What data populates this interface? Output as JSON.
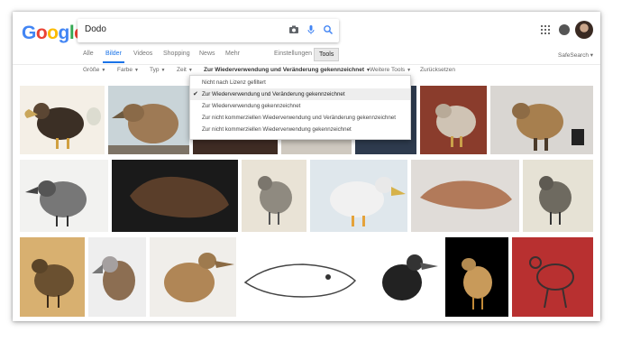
{
  "search": {
    "query": "Dodo"
  },
  "logo": {
    "letters": [
      "G",
      "o",
      "o",
      "g",
      "l",
      "e"
    ]
  },
  "tabs": {
    "items": [
      "Alle",
      "Bilder",
      "Videos",
      "Shopping",
      "News",
      "Mehr"
    ],
    "active": "Bilder",
    "settings": "Einstellungen",
    "tools": "Tools"
  },
  "safesearch": "SafeSearch",
  "filters": {
    "size": "Größe",
    "color": "Farbe",
    "type": "Typ",
    "time": "Zeit",
    "license": "Zur Wiederverwendung und Veränderung gekennzeichnet",
    "more_tools": "Weitere Tools",
    "reset": "Zurücksetzen"
  },
  "license_menu": {
    "options": [
      "Nicht nach Lizenz gefiltert",
      "Zur Wiederverwendung und Veränderung gekennzeichnet",
      "Zur Wiederverwendung gekennzeichnet",
      "Zur nicht kommerziellen Wiederverwendung und Veränderung gekennzeichnet",
      "Zur nicht kommerziellen Wiederverwendung gekennzeichnet"
    ],
    "selected_index": 1
  },
  "icons": {
    "camera": "camera-icon",
    "mic": "mic-icon",
    "search": "search-icon",
    "apps": "apps-grid-icon",
    "notifications": "notification-icon",
    "avatar": "avatar"
  },
  "colors": {
    "accent": "#1a73e8",
    "menu_selected_bg": "#eeeeee"
  }
}
